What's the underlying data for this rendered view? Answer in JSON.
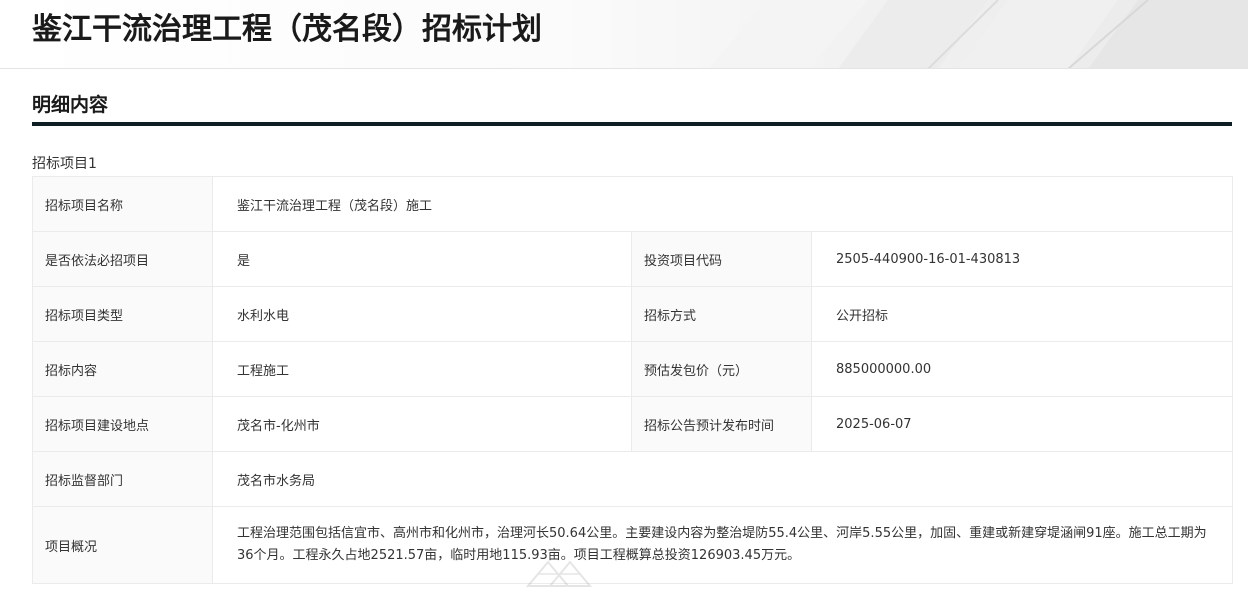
{
  "header": {
    "title": "鉴江干流治理工程（茂名段）招标计划"
  },
  "section": {
    "title": "明细内容",
    "subsection_label": "招标项目1"
  },
  "fields": {
    "project_name_label": "招标项目名称",
    "project_name_value": "鉴江干流治理工程（茂名段）施工",
    "mandatory_label": "是否依法必招项目",
    "mandatory_value": "是",
    "invest_code_label": "投资项目代码",
    "invest_code_value": "2505-440900-16-01-430813",
    "project_type_label": "招标项目类型",
    "project_type_value": "水利水电",
    "method_label": "招标方式",
    "method_value": "公开招标",
    "content_label": "招标内容",
    "content_value": "工程施工",
    "price_label": "预估发包价（元）",
    "price_value": "885000000.00",
    "location_label": "招标项目建设地点",
    "location_value": "茂名市-化州市",
    "publish_time_label": "招标公告预计发布时间",
    "publish_time_value": "2025-06-07",
    "supervisor_label": "招标监督部门",
    "supervisor_value": "茂名市水务局",
    "overview_label": "项目概况",
    "overview_value": "工程治理范围包括信宜市、高州市和化州市，治理河长50.64公里。主要建设内容为整治堤防55.4公里、河岸5.55公里，加固、重建或新建穿堤涵闸91座。施工总工期为36个月。工程永久占地2521.57亩，临时用地115.93亩。项目工程概算总投资126903.45万元。"
  },
  "colors": {
    "title": "#1a1a1a",
    "rule": "#0f1e22",
    "label_bg": "#fafafa",
    "border": "#ebebeb"
  }
}
